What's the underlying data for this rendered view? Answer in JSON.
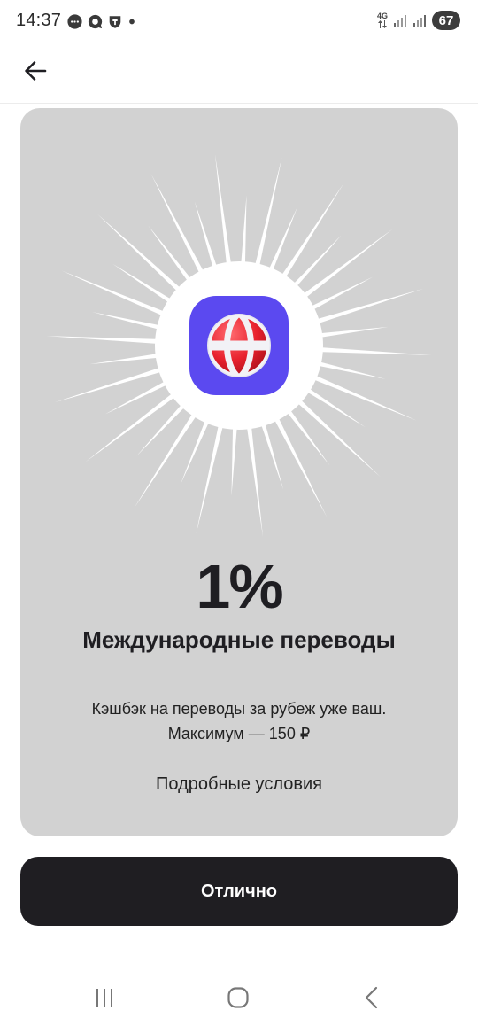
{
  "status_bar": {
    "time": "14:37",
    "network": "4G",
    "battery": "67",
    "notification_icons": [
      "message-bubble-icon",
      "chat-bubble-icon",
      "shield-icon",
      "dot-icon"
    ]
  },
  "header": {
    "back_icon": "arrow-left-icon"
  },
  "promo": {
    "icon": "globe-icon",
    "percent": "1%",
    "title": "Международные переводы",
    "description_line1": "Кэшбэк на переводы за рубеж уже ваш.",
    "description_line2": "Максимум — 150 ₽",
    "terms_link": "Подробные условия",
    "colors": {
      "card_bg": "#d2d2d2",
      "icon_bg": "#5b49f0",
      "globe_red": "#e8222e"
    }
  },
  "actions": {
    "confirm_label": "Отлично"
  },
  "nav_bar": {
    "recents_icon": "recents-icon",
    "home_icon": "home-icon",
    "back_icon": "back-chevron-icon"
  }
}
